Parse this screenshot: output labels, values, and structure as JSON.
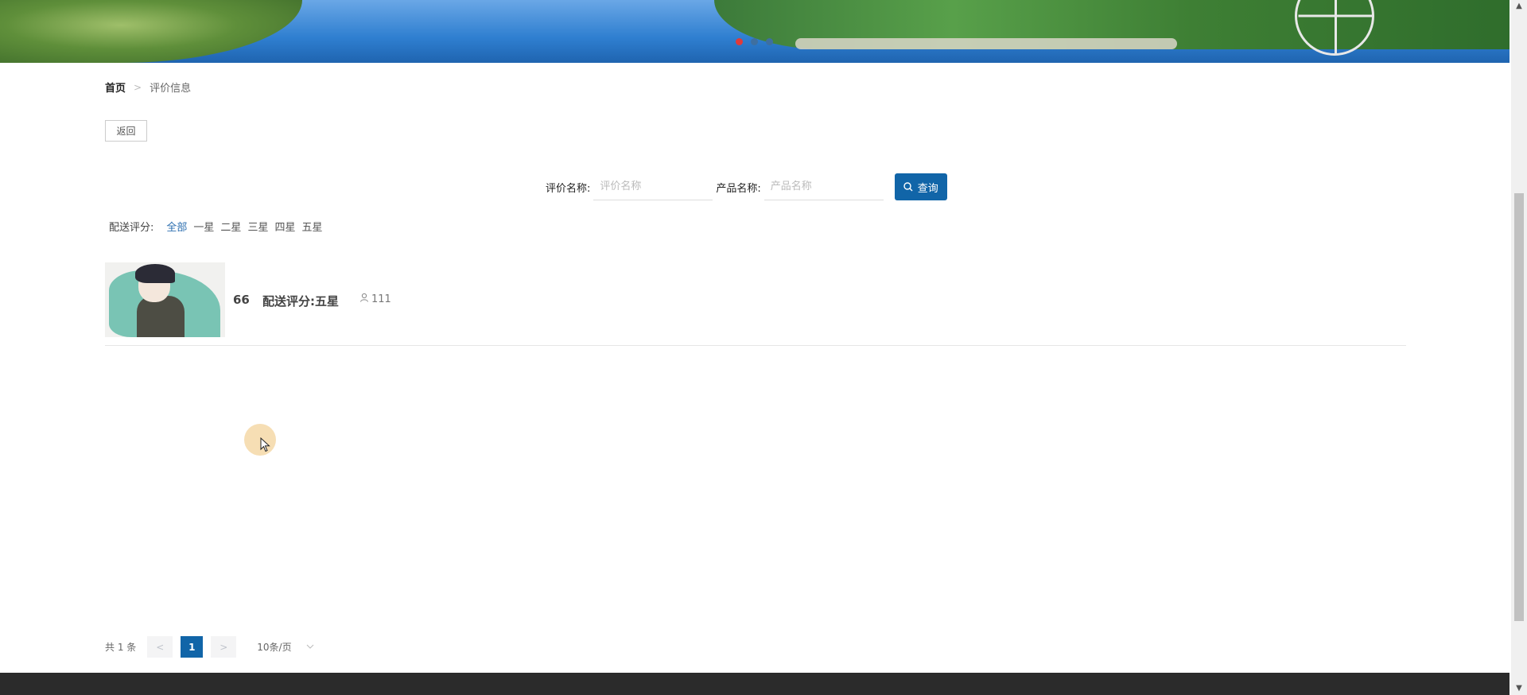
{
  "banner": {
    "slides": 3,
    "active_slide": 1
  },
  "breadcrumb": {
    "home": "首页",
    "separator": ">",
    "current": "评价信息"
  },
  "back_button": "返回",
  "search": {
    "review_name_label": "评价名称:",
    "review_name_placeholder": "评价名称",
    "product_name_label": "产品名称:",
    "product_name_placeholder": "产品名称",
    "query_label": "查询"
  },
  "filter": {
    "label": "配送评分:",
    "options": [
      "全部",
      "一星",
      "二星",
      "三星",
      "四星",
      "五星"
    ],
    "active": "全部"
  },
  "items": [
    {
      "title": "66",
      "rating": "配送评分:五星",
      "views": "111"
    }
  ],
  "pagination": {
    "total": "共 1 条",
    "prev": "<",
    "current_page": "1",
    "next": ">",
    "page_size": "10条/页"
  },
  "colors": {
    "primary": "#1165a8",
    "active_filter": "#2d6fb0",
    "footer": "#2b2b2b"
  }
}
